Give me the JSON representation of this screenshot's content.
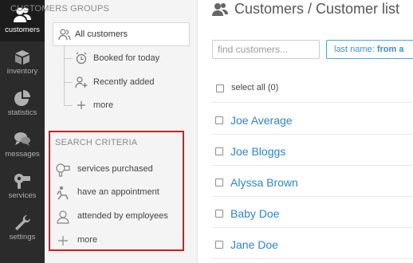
{
  "nav": {
    "items": [
      {
        "label": "customers",
        "icon": "customers-icon",
        "active": true
      },
      {
        "label": "inventory",
        "icon": "box-icon"
      },
      {
        "label": "statistics",
        "icon": "pie-chart-icon"
      },
      {
        "label": "messages",
        "icon": "chat-icon"
      },
      {
        "label": "services",
        "icon": "hair-dryer-icon"
      },
      {
        "label": "settings",
        "icon": "wrench-icon"
      }
    ]
  },
  "groups": {
    "title": "CUSTOMERS GROUPS",
    "all": "All customers",
    "items": [
      "Booked for today",
      "Recently added",
      "more"
    ]
  },
  "criteria": {
    "title": "SEARCH CRITERIA",
    "items": [
      "services purchased",
      "have an appointment",
      "attended by employees",
      "more"
    ]
  },
  "main": {
    "title": "Customers / Customer list",
    "search_placeholder": "find customers...",
    "sort_prefix": "last name:",
    "sort_value": "from a",
    "select_all": "select all (0)",
    "customers": [
      "Joe Average",
      "Joe Bloggs",
      "Alyssa Brown",
      "Baby Doe",
      "Jane Doe"
    ]
  },
  "colors": {
    "accent": "#2f84c2",
    "highlight_border": "#d61c1c",
    "rail_bg": "#2b2b2b"
  }
}
